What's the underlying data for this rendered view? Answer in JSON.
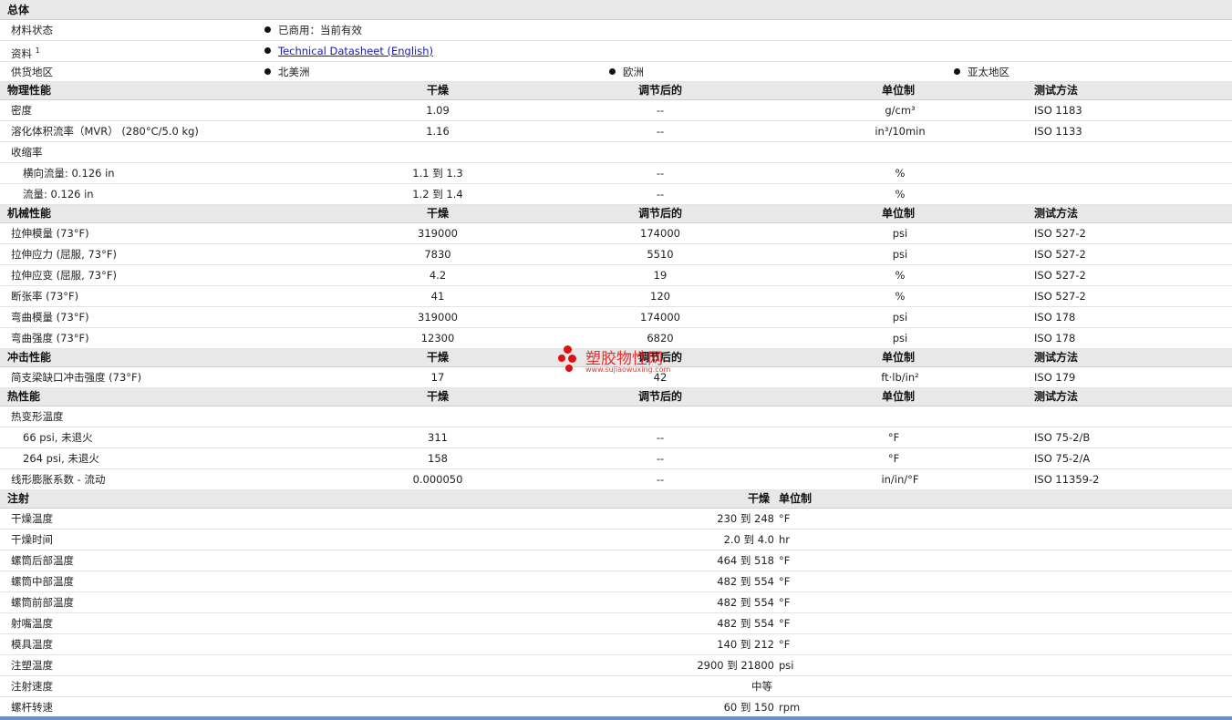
{
  "general": {
    "title": "总体",
    "material_status_label": "材料状态",
    "material_status_value": "已商用：当前有效",
    "documents_label": "资料",
    "documents_sup": "1",
    "datasheet_link": "Technical Datasheet (English)",
    "regions_label": "供货地区",
    "regions": [
      "北美洲",
      "欧洲",
      "亚太地区"
    ]
  },
  "physical": {
    "title": "物理性能",
    "headers": {
      "dry": "干燥",
      "cond": "调节后的",
      "unit": "单位制",
      "method": "测试方法"
    },
    "rows": [
      {
        "name": "密度",
        "dry": "1.09",
        "cond": "--",
        "unit": "g/cm³",
        "method": "ISO 1183"
      },
      {
        "name": "溶化体积流率（MVR） (280°C/5.0 kg)",
        "dry": "1.16",
        "cond": "--",
        "unit": "in³/10min",
        "method": "ISO 1133"
      },
      {
        "name": "收缩率",
        "dry": "",
        "cond": "",
        "unit": "",
        "method": ""
      },
      {
        "name": "横向流量: 0.126 in",
        "dry": "1.1 到 1.3",
        "cond": "--",
        "unit": "%",
        "method": ""
      },
      {
        "name": "流量: 0.126 in",
        "dry": "1.2 到 1.4",
        "cond": "--",
        "unit": "%",
        "method": ""
      }
    ]
  },
  "mechanical": {
    "title": "机械性能",
    "headers": {
      "dry": "干燥",
      "cond": "调节后的",
      "unit": "单位制",
      "method": "测试方法"
    },
    "rows": [
      {
        "name": "拉伸模量 (73°F)",
        "dry": "319000",
        "cond": "174000",
        "unit": "psi",
        "method": "ISO 527-2"
      },
      {
        "name": "拉伸应力 (屈服, 73°F)",
        "dry": "7830",
        "cond": "5510",
        "unit": "psi",
        "method": "ISO 527-2"
      },
      {
        "name": "拉伸应变 (屈服, 73°F)",
        "dry": "4.2",
        "cond": "19",
        "unit": "%",
        "method": "ISO 527-2"
      },
      {
        "name": "断张率 (73°F)",
        "dry": "41",
        "cond": "120",
        "unit": "%",
        "method": "ISO 527-2"
      },
      {
        "name": "弯曲模量 (73°F)",
        "dry": "319000",
        "cond": "174000",
        "unit": "psi",
        "method": "ISO 178"
      },
      {
        "name": "弯曲强度 (73°F)",
        "dry": "12300",
        "cond": "6820",
        "unit": "psi",
        "method": "ISO 178"
      }
    ]
  },
  "impact": {
    "title": "冲击性能",
    "headers": {
      "dry": "干燥",
      "cond": "调节后的",
      "unit": "单位制",
      "method": "测试方法"
    },
    "rows": [
      {
        "name": "简支梁缺口冲击强度 (73°F)",
        "dry": "17",
        "cond": "42",
        "unit": "ft·lb/in²",
        "method": "ISO 179"
      }
    ]
  },
  "thermal": {
    "title": "热性能",
    "headers": {
      "dry": "干燥",
      "cond": "调节后的",
      "unit": "单位制",
      "method": "测试方法"
    },
    "rows": [
      {
        "name": "热变形温度",
        "dry": "",
        "cond": "",
        "unit": "",
        "method": ""
      },
      {
        "name": "66 psi, 未退火",
        "dry": "311",
        "cond": "--",
        "unit": "°F",
        "method": "ISO 75-2/B"
      },
      {
        "name": "264 psi, 未退火",
        "dry": "158",
        "cond": "--",
        "unit": "°F",
        "method": "ISO 75-2/A"
      },
      {
        "name": "线形膨胀系数 - 流动",
        "dry": "0.000050",
        "cond": "--",
        "unit": "in/in/°F",
        "method": "ISO 11359-2"
      }
    ]
  },
  "injection": {
    "title": "注射",
    "headers": {
      "dry": "干燥",
      "unit": "单位制"
    },
    "rows": [
      {
        "name": "干燥温度",
        "value": "230 到 248",
        "unit": "°F"
      },
      {
        "name": "干燥时间",
        "value": "2.0 到 4.0",
        "unit": "hr"
      },
      {
        "name": "螺筒后部温度",
        "value": "464 到 518",
        "unit": "°F"
      },
      {
        "name": "螺筒中部温度",
        "value": "482 到 554",
        "unit": "°F"
      },
      {
        "name": "螺筒前部温度",
        "value": "482 到 554",
        "unit": "°F"
      },
      {
        "name": "射嘴温度",
        "value": "482 到 554",
        "unit": "°F"
      },
      {
        "name": "模具温度",
        "value": "140 到 212",
        "unit": "°F"
      },
      {
        "name": "注塑温度",
        "value": "2900 到 21800",
        "unit": "psi"
      },
      {
        "name": "注射速度",
        "value": "中等",
        "unit": ""
      },
      {
        "name": "螺杆转速",
        "value": "60 到 150",
        "unit": "rpm"
      }
    ]
  },
  "watermark": {
    "text": "塑胶物性网",
    "url": "www.sujiaowuxing.com",
    "color": "#e01010"
  }
}
